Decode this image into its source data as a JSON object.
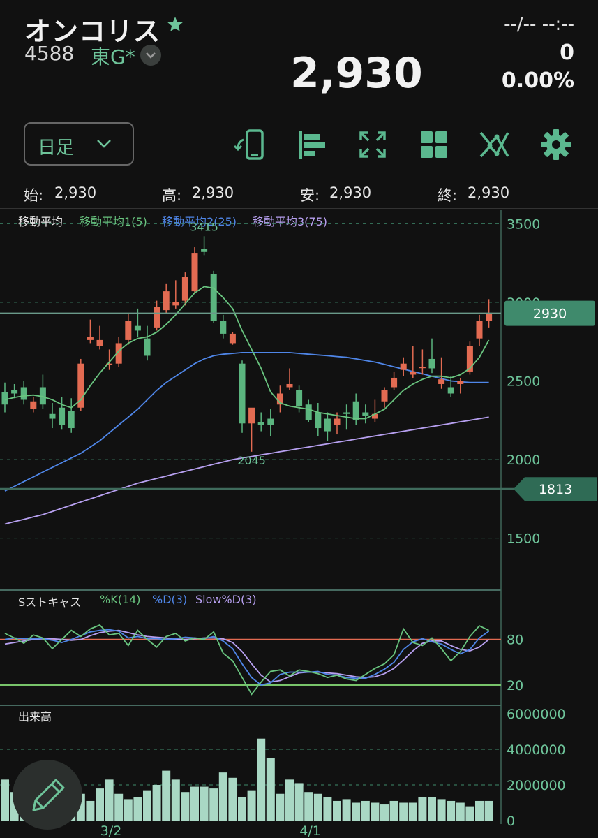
{
  "header": {
    "name": "オンコリス",
    "code": "4588",
    "market": "東G*",
    "time": "--/-- --:--",
    "price": "2,930",
    "change": "0",
    "change_pct": "0.00%"
  },
  "toolbar": {
    "period_label": "日足",
    "icons": [
      "phone-rotate-icon",
      "bar-align-icon",
      "expand-icon",
      "grid-icon",
      "indicator-icon",
      "gear-icon"
    ]
  },
  "ohlc": {
    "open_label": "始:",
    "open": "2,930",
    "high_label": "高:",
    "high": "2,930",
    "low_label": "安:",
    "low": "2,930",
    "close_label": "終:",
    "close": "2,930"
  },
  "main_legend": {
    "title": "移動平均",
    "ma1": "移動平均1(5)",
    "ma2": "移動平均2(25)",
    "ma3": "移動平均3(75)"
  },
  "stoch_legend": {
    "title": "Sストキャス",
    "k": "%K(14)",
    "d": "%D(3)",
    "slowd": "Slow%D(3)"
  },
  "volume_legend": {
    "title": "出来高"
  },
  "colors": {
    "up": "#e36b52",
    "down": "#5bb57f",
    "accent": "#6ec49a",
    "ma1": "#69c47f",
    "ma2": "#4f86e8",
    "ma3": "#b7a0f0",
    "line80": "#e36b52",
    "line20": "#78c46a",
    "volume": "#a9d8c4"
  },
  "chart_data": [
    {
      "type": "candlestick",
      "title": "移動平均",
      "y_ticks": [
        3500,
        3000,
        2500,
        2000,
        1500
      ],
      "ylim": [
        1170,
        3590
      ],
      "current_price_label": "2930",
      "line_label": "1813",
      "annotations": {
        "high": "3415",
        "low": "2045"
      },
      "x_ticks": [
        "3/2",
        "4/1"
      ],
      "x_tick_index": [
        10,
        31
      ],
      "candles": [
        [
          2430,
          2490,
          2300,
          2350
        ],
        [
          2440,
          2480,
          2390,
          2420
        ],
        [
          2460,
          2500,
          2350,
          2380
        ],
        [
          2320,
          2400,
          2300,
          2370
        ],
        [
          2460,
          2540,
          2320,
          2350
        ],
        [
          2290,
          2360,
          2200,
          2260
        ],
        [
          2330,
          2400,
          2190,
          2220
        ],
        [
          2310,
          2390,
          2170,
          2200
        ],
        [
          2330,
          2640,
          2310,
          2610
        ],
        [
          2760,
          2890,
          2740,
          2780
        ],
        [
          2720,
          2850,
          2700,
          2760
        ],
        [
          2610,
          2700,
          2570,
          2610
        ],
        [
          2610,
          2780,
          2590,
          2740
        ],
        [
          2760,
          2930,
          2730,
          2880
        ],
        [
          2850,
          2960,
          2780,
          2820
        ],
        [
          2770,
          2850,
          2630,
          2660
        ],
        [
          2840,
          3010,
          2820,
          2970
        ],
        [
          2950,
          3120,
          2930,
          3070
        ],
        [
          2980,
          3140,
          2960,
          3000
        ],
        [
          3010,
          3190,
          2980,
          3160
        ],
        [
          3070,
          3350,
          3060,
          3310
        ],
        [
          3340,
          3420,
          3300,
          3320
        ],
        [
          3180,
          3200,
          2870,
          2880
        ],
        [
          2880,
          2920,
          2770,
          2800
        ],
        [
          2740,
          2810,
          2730,
          2800
        ],
        [
          2610,
          2630,
          2170,
          2230
        ],
        [
          2230,
          2300,
          2050,
          2330
        ],
        [
          2240,
          2300,
          2180,
          2220
        ],
        [
          2260,
          2320,
          2150,
          2220
        ],
        [
          2350,
          2470,
          2300,
          2420
        ],
        [
          2460,
          2580,
          2440,
          2480
        ],
        [
          2440,
          2470,
          2300,
          2340
        ],
        [
          2350,
          2380,
          2240,
          2250
        ],
        [
          2300,
          2360,
          2150,
          2200
        ],
        [
          2260,
          2300,
          2120,
          2180
        ],
        [
          2220,
          2300,
          2160,
          2260
        ],
        [
          2300,
          2350,
          2190,
          2290
        ],
        [
          2370,
          2420,
          2220,
          2250
        ],
        [
          2300,
          2350,
          2230,
          2280
        ],
        [
          2260,
          2380,
          2240,
          2290
        ],
        [
          2370,
          2460,
          2330,
          2440
        ],
        [
          2460,
          2560,
          2440,
          2520
        ],
        [
          2570,
          2650,
          2530,
          2610
        ],
        [
          2540,
          2720,
          2520,
          2560
        ],
        [
          2590,
          2700,
          2540,
          2590
        ],
        [
          2640,
          2770,
          2550,
          2580
        ],
        [
          2480,
          2650,
          2450,
          2510
        ],
        [
          2460,
          2530,
          2400,
          2420
        ],
        [
          2480,
          2520,
          2420,
          2500
        ],
        [
          2560,
          2750,
          2540,
          2720
        ],
        [
          2770,
          2920,
          2720,
          2880
        ],
        [
          2880,
          3020,
          2840,
          2930
        ]
      ],
      "ma1": [
        2380,
        2395,
        2405,
        2410,
        2400,
        2380,
        2350,
        2330,
        2380,
        2470,
        2550,
        2620,
        2690,
        2740,
        2770,
        2780,
        2810,
        2860,
        2920,
        2990,
        3060,
        3100,
        3090,
        3030,
        2960,
        2820,
        2700,
        2580,
        2430,
        2360,
        2340,
        2330,
        2320,
        2300,
        2290,
        2280,
        2270,
        2260,
        2260,
        2290,
        2320,
        2380,
        2440,
        2480,
        2510,
        2530,
        2530,
        2520,
        2540,
        2580,
        2650,
        2760
      ],
      "ma2": [
        1800,
        1830,
        1860,
        1890,
        1920,
        1950,
        1980,
        2010,
        2040,
        2080,
        2120,
        2170,
        2220,
        2270,
        2320,
        2380,
        2440,
        2490,
        2530,
        2570,
        2610,
        2640,
        2660,
        2670,
        2675,
        2680,
        2680,
        2680,
        2680,
        2680,
        2680,
        2675,
        2670,
        2665,
        2660,
        2655,
        2650,
        2640,
        2630,
        2620,
        2605,
        2590,
        2575,
        2560,
        2545,
        2530,
        2515,
        2500,
        2495,
        2490,
        2490,
        2490
      ],
      "ma3": [
        1590,
        1605,
        1620,
        1635,
        1650,
        1670,
        1690,
        1710,
        1730,
        1750,
        1770,
        1790,
        1810,
        1830,
        1850,
        1865,
        1880,
        1895,
        1910,
        1925,
        1940,
        1955,
        1970,
        1985,
        2000,
        2010,
        2020,
        2030,
        2040,
        2050,
        2060,
        2070,
        2080,
        2090,
        2100,
        2110,
        2120,
        2130,
        2140,
        2150,
        2160,
        2170,
        2180,
        2190,
        2200,
        2210,
        2220,
        2230,
        2240,
        2250,
        2260,
        2270
      ]
    },
    {
      "type": "line",
      "title": "Sストキャス",
      "y_ticks": [
        80,
        20
      ],
      "ylim": [
        -2,
        122
      ],
      "series": [
        {
          "name": "%K(14)",
          "values": [
            88,
            82,
            75,
            86,
            82,
            68,
            80,
            92,
            84,
            94,
            99,
            86,
            88,
            72,
            92,
            80,
            70,
            84,
            88,
            78,
            82,
            80,
            90,
            62,
            52,
            30,
            8,
            24,
            38,
            40,
            32,
            40,
            38,
            35,
            30,
            33,
            28,
            26,
            34,
            42,
            48,
            60,
            94,
            76,
            72,
            82,
            68,
            52,
            64,
            84,
            98,
            92
          ]
        },
        {
          "name": "%D(3)",
          "values": [
            80,
            82,
            81,
            81,
            81,
            79,
            76,
            80,
            85,
            90,
            92,
            93,
            91,
            82,
            84,
            81,
            81,
            80,
            81,
            83,
            82,
            81,
            84,
            78,
            68,
            48,
            30,
            20,
            23,
            34,
            37,
            37,
            37,
            38,
            34,
            33,
            30,
            29,
            29,
            34,
            41,
            50,
            67,
            77,
            81,
            77,
            74,
            67,
            61,
            67,
            82,
            91
          ]
        },
        {
          "name": "Slow%D(3)",
          "values": [
            74,
            76,
            78,
            80,
            81,
            81,
            80,
            79,
            80,
            85,
            89,
            91,
            92,
            89,
            86,
            84,
            83,
            82,
            80,
            80,
            81,
            82,
            82,
            81,
            76,
            64,
            48,
            33,
            24,
            26,
            31,
            36,
            37,
            37,
            36,
            35,
            33,
            31,
            30,
            31,
            35,
            42,
            53,
            65,
            75,
            78,
            78,
            72,
            67,
            65,
            70,
            80
          ]
        }
      ]
    },
    {
      "type": "bar",
      "title": "出来高",
      "y_ticks": [
        6000000,
        4000000,
        2000000,
        0
      ],
      "ylim": [
        0,
        6000000
      ],
      "values": [
        2300000,
        1600000,
        1500000,
        800000,
        1300000,
        1600000,
        1300000,
        1300000,
        1500000,
        1100000,
        1800000,
        2300000,
        1500000,
        1200000,
        1300000,
        1700000,
        2000000,
        2800000,
        2300000,
        1600000,
        1900000,
        1900000,
        1800000,
        2700000,
        2400000,
        1300000,
        1700000,
        4600000,
        3500000,
        1500000,
        2300000,
        2100000,
        1600000,
        1500000,
        1300000,
        1100000,
        1200000,
        1000000,
        1100000,
        1000000,
        900000,
        1100000,
        1000000,
        1000000,
        1300000,
        1300000,
        1200000,
        1100000,
        1000000,
        800000,
        1100000,
        1100000
      ]
    }
  ]
}
